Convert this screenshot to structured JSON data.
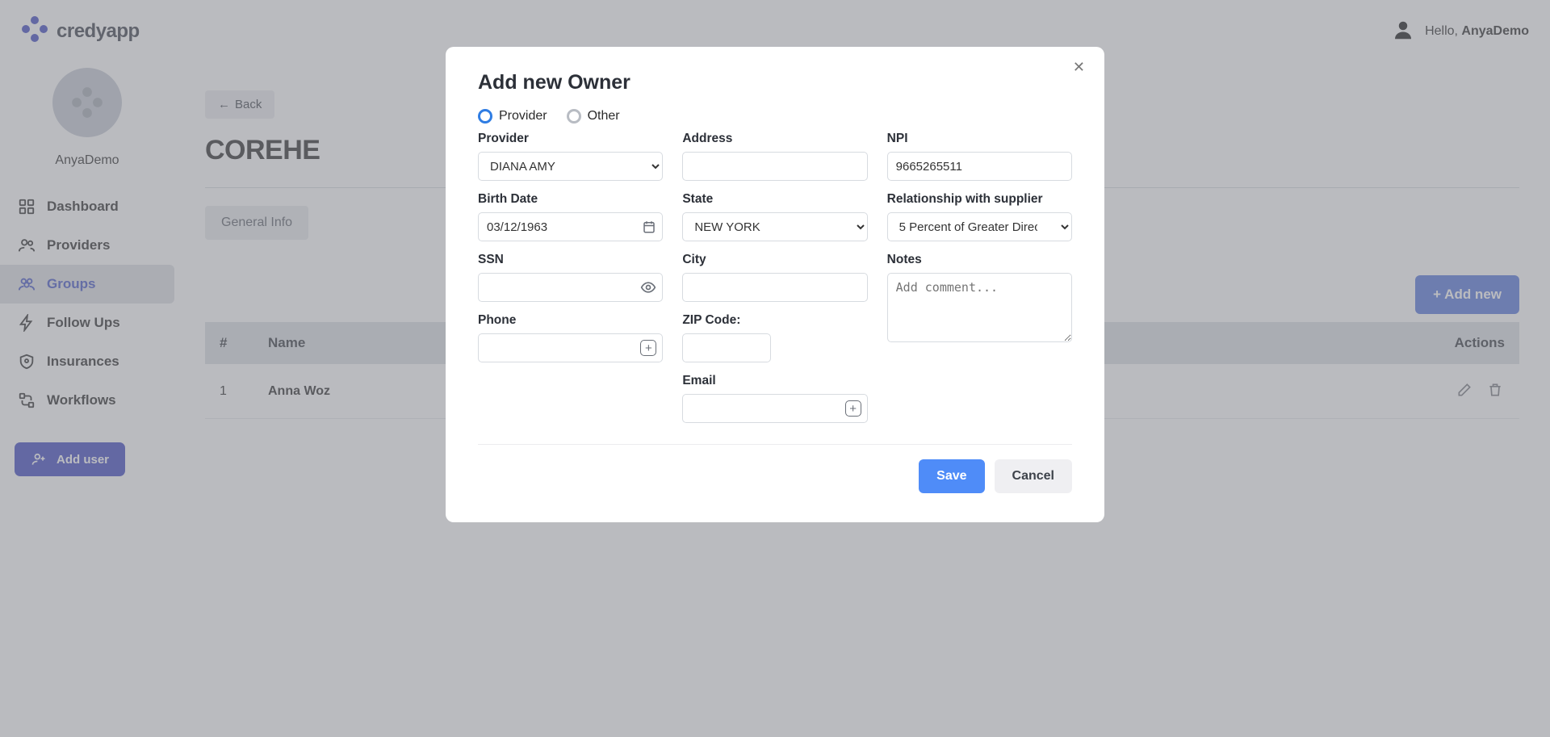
{
  "app": {
    "name": "credyapp"
  },
  "user": {
    "greeting": "Hello,",
    "name": "AnyaDemo"
  },
  "sidebar": {
    "profile_name": "AnyaDemo",
    "items": [
      {
        "label": "Dashboard"
      },
      {
        "label": "Providers"
      },
      {
        "label": "Groups"
      },
      {
        "label": "Follow Ups"
      },
      {
        "label": "Insurances"
      },
      {
        "label": "Workflows"
      }
    ],
    "add_user_label": "Add user"
  },
  "main": {
    "back_label": "Back",
    "page_title": "COREHE",
    "tab_general": "General Info",
    "add_new_label": "+ Add new",
    "columns": {
      "num": "#",
      "name": "Name",
      "actions": "Actions"
    },
    "rows": [
      {
        "num": "1",
        "name": "Anna Woz"
      }
    ]
  },
  "modal": {
    "title": "Add new Owner",
    "radios": {
      "provider": "Provider",
      "other": "Other"
    },
    "labels": {
      "provider": "Provider",
      "address": "Address",
      "npi": "NPI",
      "birth_date": "Birth Date",
      "state": "State",
      "relationship": "Relationship with supplier",
      "ssn": "SSN",
      "city": "City",
      "notes": "Notes",
      "phone": "Phone",
      "zip": "ZIP Code:",
      "email": "Email"
    },
    "values": {
      "provider_selected": "DIANA AMY",
      "address": "",
      "npi": "9665265511",
      "birth_date": "03/12/1963",
      "state_selected": "NEW YORK",
      "relationship_selected": "5 Percent of Greater Direc",
      "ssn": "",
      "city": "",
      "notes_placeholder": "Add comment...",
      "phone": "",
      "zip": "",
      "email": ""
    },
    "actions": {
      "save": "Save",
      "cancel": "Cancel"
    }
  }
}
